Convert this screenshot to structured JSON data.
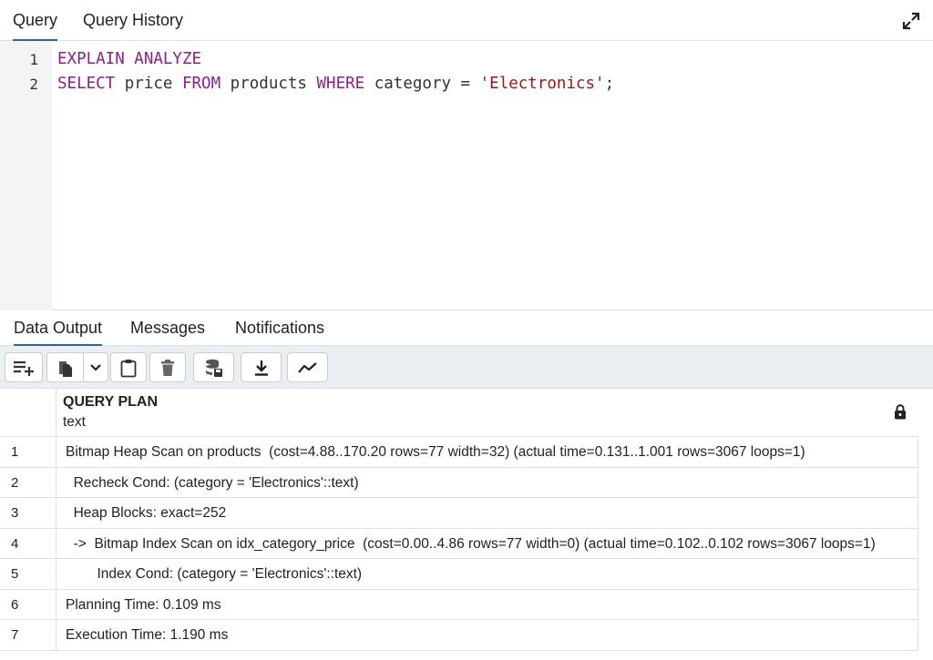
{
  "query_tabs": [
    {
      "label": "Query",
      "active": true
    },
    {
      "label": "Query History",
      "active": false
    }
  ],
  "editor": {
    "lines": [
      {
        "number": "1",
        "tokens": [
          {
            "t": "kw",
            "v": "EXPLAIN ANALYZE"
          }
        ]
      },
      {
        "number": "2",
        "tokens": [
          {
            "t": "kw",
            "v": "SELECT"
          },
          {
            "t": "plain",
            "v": " price "
          },
          {
            "t": "kw",
            "v": "FROM"
          },
          {
            "t": "plain",
            "v": " products "
          },
          {
            "t": "kw",
            "v": "WHERE"
          },
          {
            "t": "plain",
            "v": " category = "
          },
          {
            "t": "str",
            "v": "'Electronics'"
          },
          {
            "t": "plain",
            "v": ";"
          }
        ]
      }
    ]
  },
  "output_tabs": [
    {
      "label": "Data Output",
      "active": true
    },
    {
      "label": "Messages",
      "active": false
    },
    {
      "label": "Notifications",
      "active": false
    }
  ],
  "toolbar_icons": [
    "add-row-icon",
    "copy-icon",
    "chevron-down-icon",
    "paste-icon",
    "delete-icon",
    "save-data-icon",
    "download-icon",
    "graph-icon"
  ],
  "grid": {
    "column": {
      "name": "QUERY PLAN",
      "type": "text"
    },
    "lock_icon": "lock-icon",
    "rows": [
      {
        "num": "1",
        "value": "Bitmap Heap Scan on products  (cost=4.88..170.20 rows=77 width=32) (actual time=0.131..1.001 rows=3067 loops=1)"
      },
      {
        "num": "2",
        "value": "  Recheck Cond: (category = 'Electronics'::text)"
      },
      {
        "num": "3",
        "value": "  Heap Blocks: exact=252"
      },
      {
        "num": "4",
        "value": "  ->  Bitmap Index Scan on idx_category_price  (cost=0.00..4.86 rows=77 width=0) (actual time=0.102..0.102 rows=3067 loops=1)"
      },
      {
        "num": "5",
        "value": "        Index Cond: (category = 'Electronics'::text)"
      },
      {
        "num": "6",
        "value": "Planning Time: 0.109 ms"
      },
      {
        "num": "7",
        "value": "Execution Time: 1.190 ms"
      }
    ]
  },
  "colors": {
    "accent": "#326690",
    "keyword": "#8b1f8f",
    "string": "#a31515"
  }
}
